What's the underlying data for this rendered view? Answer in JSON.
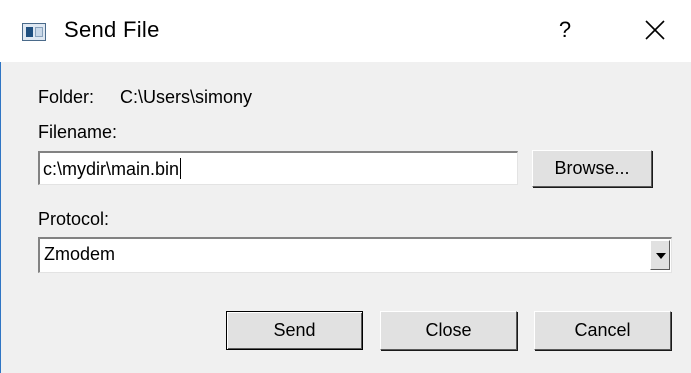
{
  "titlebar": {
    "title": "Send File",
    "help_glyph": "?",
    "icons": {
      "app": "app-window-icon",
      "close": "close-icon"
    }
  },
  "folder": {
    "label": "Folder:",
    "value": "C:\\Users\\simony"
  },
  "filename": {
    "label": "Filename:",
    "value": "c:\\mydir\\main.bin",
    "browse_label": "Browse..."
  },
  "protocol": {
    "label": "Protocol:",
    "selected": "Zmodem"
  },
  "buttons": {
    "send": "Send",
    "close": "Close",
    "cancel": "Cancel"
  }
}
